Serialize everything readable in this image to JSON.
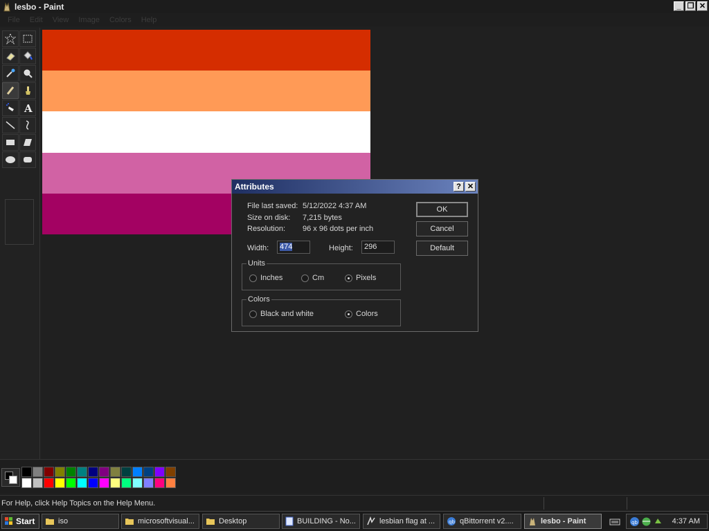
{
  "window": {
    "title": "lesbo - Paint",
    "controls": {
      "minimize": "_",
      "restore": "❐",
      "close": "✕"
    }
  },
  "menu": [
    "File",
    "Edit",
    "View",
    "Image",
    "Colors",
    "Help"
  ],
  "tools": [
    {
      "name": "free-select",
      "icon": "star-select-icon"
    },
    {
      "name": "rect-select",
      "icon": "rect-select-icon"
    },
    {
      "name": "eraser",
      "icon": "eraser-icon"
    },
    {
      "name": "fill",
      "icon": "paint-bucket-icon"
    },
    {
      "name": "pick-color",
      "icon": "eyedropper-icon"
    },
    {
      "name": "magnifier",
      "icon": "magnifier-icon"
    },
    {
      "name": "pencil",
      "icon": "pencil-icon"
    },
    {
      "name": "brush",
      "icon": "brush-icon"
    },
    {
      "name": "airbrush",
      "icon": "airbrush-icon"
    },
    {
      "name": "text",
      "icon": "text-icon"
    },
    {
      "name": "line",
      "icon": "line-icon"
    },
    {
      "name": "curve",
      "icon": "curve-icon"
    },
    {
      "name": "rectangle",
      "icon": "rectangle-icon"
    },
    {
      "name": "polygon",
      "icon": "polygon-icon"
    },
    {
      "name": "ellipse",
      "icon": "ellipse-icon"
    },
    {
      "name": "rounded-rect",
      "icon": "rounded-rectangle-icon"
    }
  ],
  "active_tool": "pencil",
  "flag_colors": [
    "#d52d00",
    "#ff9a56",
    "#ffffff",
    "#d162a4",
    "#a30262"
  ],
  "palette": [
    "#000000",
    "#808080",
    "#800000",
    "#808000",
    "#008000",
    "#008080",
    "#000080",
    "#800080",
    "#808040",
    "#004040",
    "#0080ff",
    "#004080",
    "#8000ff",
    "#804000",
    "#ffffff",
    "#c0c0c0",
    "#ff0000",
    "#ffff00",
    "#00ff00",
    "#00ffff",
    "#0000ff",
    "#ff00ff",
    "#ffff80",
    "#00ff80",
    "#80ffff",
    "#8080ff",
    "#ff0080",
    "#ff8040"
  ],
  "status": {
    "help_text": "For Help, click Help Topics on the Help Menu."
  },
  "dialog": {
    "title": "Attributes",
    "help_glyph": "?",
    "close_glyph": "✕",
    "file_last_saved_label": "File last saved:",
    "file_last_saved_value": "5/12/2022 4:37 AM",
    "size_label": "Size on disk:",
    "size_value": "7,215 bytes",
    "resolution_label": "Resolution:",
    "resolution_value": "96 x 96 dots per inch",
    "width_label": "Width:",
    "width_value": "474",
    "height_label": "Height:",
    "height_value": "296",
    "units_label": "Units",
    "units": {
      "inches": "Inches",
      "cm": "Cm",
      "pixels": "Pixels"
    },
    "units_selected": "pixels",
    "colors_label": "Colors",
    "colors": {
      "bw": "Black and white",
      "colors": "Colors"
    },
    "colors_selected": "colors",
    "ok_label": "OK",
    "cancel_label": "Cancel",
    "default_label": "Default"
  },
  "taskbar": {
    "start_label": "Start",
    "tasks": [
      {
        "label": "iso",
        "icon": "folder-icon"
      },
      {
        "label": "microsoftvisual...",
        "icon": "folder-icon"
      },
      {
        "label": "Desktop",
        "icon": "folder-icon"
      },
      {
        "label": "BUILDING - No...",
        "icon": "notepad-icon"
      },
      {
        "label": "lesbian flag at ...",
        "icon": "browser-icon"
      },
      {
        "label": "qBittorrent v2....",
        "icon": "qbittorrent-icon"
      },
      {
        "label": "lesbo - Paint",
        "icon": "paint-icon"
      }
    ],
    "clock": "4:37 AM"
  }
}
